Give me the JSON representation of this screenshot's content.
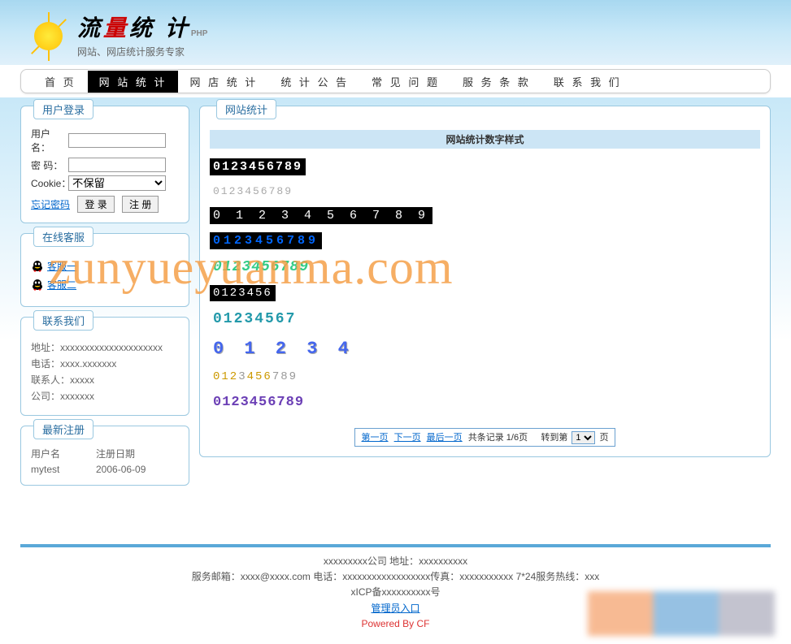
{
  "logo": {
    "t1": "流",
    "t2": "量",
    "t3": "统 计",
    "php": "PHP"
  },
  "tagline": "网站、网店统计服务专家",
  "nav": {
    "items": [
      "首 页",
      "网 站 统 计",
      "网 店 统 计",
      "统 计 公 告",
      "常 见 问 题",
      "服 务 条 款",
      "联 系 我 们"
    ],
    "activeIndex": 1
  },
  "loginPanel": {
    "title": "用户登录",
    "userLabel": "用户名：",
    "pwdLabel": "密 码：",
    "cookieLabel": "Cookie：",
    "cookieOption": "不保留",
    "forgot": "忘记密码",
    "loginBtn": "登 录",
    "regBtn": "注 册"
  },
  "csPanel": {
    "title": "在线客服",
    "items": [
      "客服一",
      "客服二"
    ]
  },
  "contactPanel": {
    "title": "联系我们",
    "rows": {
      "addr": "地址：xxxxxxxxxxxxxxxxxxxxx",
      "phone": "电话：xxxx.xxxxxxx",
      "person": "联系人：xxxxx",
      "company": "公司：xxxxxxx"
    }
  },
  "latestPanel": {
    "title": "最新注册",
    "headers": {
      "user": "用户名",
      "date": "注册日期"
    },
    "rows": [
      {
        "user": "mytest",
        "date": "2006-06-09"
      }
    ]
  },
  "mainPanel": {
    "title": "网站统计",
    "subheader": "网站统计数字样式",
    "counters": [
      "0123456789",
      "0123456789",
      "0 1 2 3 4 5 6 7 8 9",
      "0123456789",
      "0123456789",
      "0123456",
      "01234567",
      "0 1 2 3 4",
      "0123456789",
      "0123456789"
    ],
    "pager": {
      "first": "第一页",
      "prev": "下一页",
      "last": "最后一页",
      "total": "共条记录 1/6页",
      "jump1": "转到第",
      "jump2": "页",
      "sel": "1"
    }
  },
  "watermark": "zunyueyuanma.com",
  "footer": {
    "line1": "xxxxxxxxx公司 地址：xxxxxxxxxx",
    "line2": "服务邮箱：xxxx@xxxx.com 电话：xxxxxxxxxxxxxxxxxx传真：xxxxxxxxxxx 7*24服务热线：xxx",
    "line3": "xICP备xxxxxxxxxx号",
    "admin": "管理员入口",
    "powered": "Powered By CF"
  }
}
